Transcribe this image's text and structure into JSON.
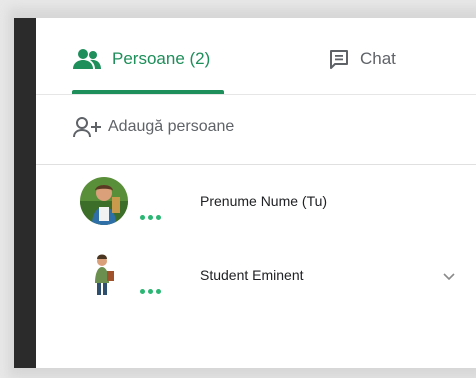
{
  "tabs": {
    "people_label": "Persoane (2)",
    "chat_label": "Chat"
  },
  "actions": {
    "add_people_label": "Adaugă persoane"
  },
  "participants": [
    {
      "name": "Prenume Nume (Tu)",
      "icon": "avatar-teacher"
    },
    {
      "name": "Student Eminent",
      "icon": "avatar-student"
    }
  ],
  "colors": {
    "accent": "#1e8e5a",
    "status_dots": "#2bb673",
    "text_secondary": "#5f6368"
  }
}
